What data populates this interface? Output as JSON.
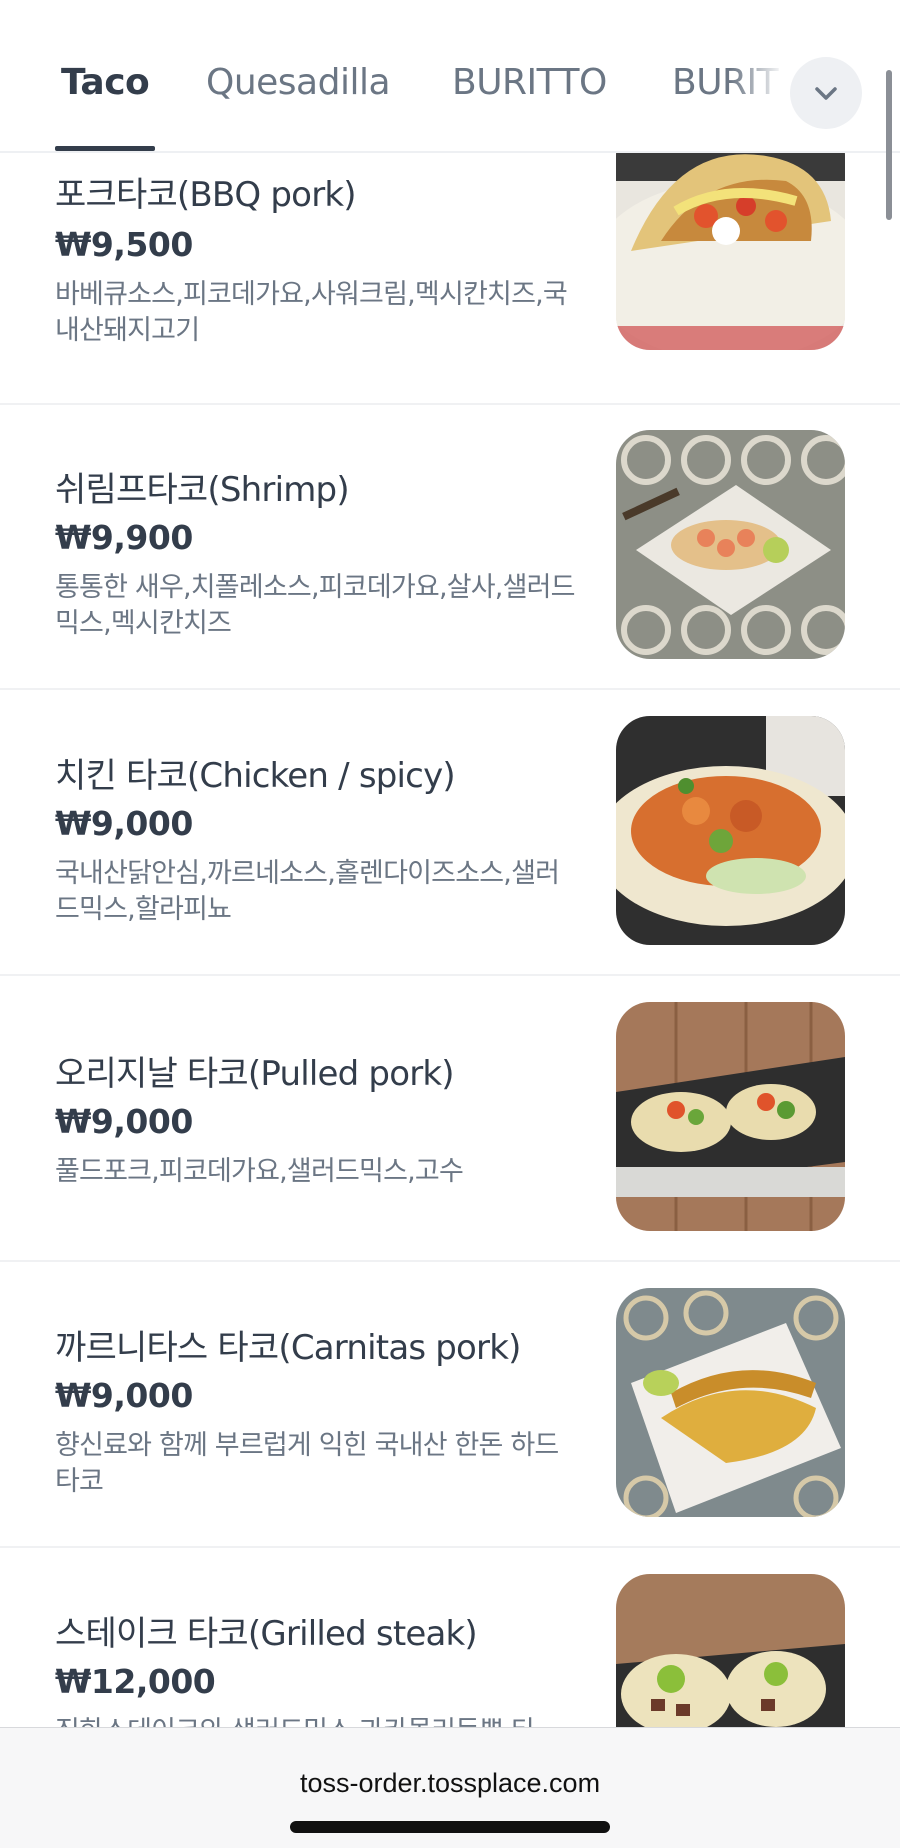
{
  "tabs": [
    {
      "label": "Taco",
      "active": true
    },
    {
      "label": "Quesadilla",
      "active": false
    },
    {
      "label": "BURITTO",
      "active": false
    },
    {
      "label": "BURIT",
      "active": false
    }
  ],
  "menu_items": [
    {
      "name": "포크타코(BBQ pork)",
      "price": "₩9,500",
      "description": "바베큐소스,피코데가요,사워크림,멕시칸치즈,국내산돼지고기",
      "image": "taco-photo"
    },
    {
      "name": "쉬림프타코(Shrimp)",
      "price": "₩9,900",
      "description": "통통한 새우,치폴레소스,피코데가요,살사,샐러드믹스,멕시칸치즈",
      "image": "taco-photo"
    },
    {
      "name": "치킨 타코(Chicken / spicy)",
      "price": "₩9,000",
      "description": "국내산닭안심,까르네소스,홀렌다이즈소스,샐러드믹스,할라피뇨",
      "image": "taco-photo"
    },
    {
      "name": "오리지날 타코(Pulled pork)",
      "price": "₩9,000",
      "description": "풀드포크,피코데가요,샐러드믹스,고수",
      "image": "taco-photo"
    },
    {
      "name": "까르니타스 타코(Carnitas pork)",
      "price": "₩9,000",
      "description": "향신료와 함께 부르럽게 익힌 국내산 한돈 하드 타코",
      "image": "taco-photo"
    },
    {
      "name": "스테이크 타코(Grilled steak)",
      "price": "₩12,000",
      "description": "직화스테이크와 샐러드믹스 과카몰리등뿌 타",
      "image": "taco-photo"
    }
  ],
  "browser": {
    "url": "toss-order.tossplace.com"
  },
  "icons": {
    "expand": "chevron-down-icon"
  },
  "colors": {
    "text": "#333d4b",
    "secondary": "#6b7684",
    "divider": "#f0f1f3"
  }
}
